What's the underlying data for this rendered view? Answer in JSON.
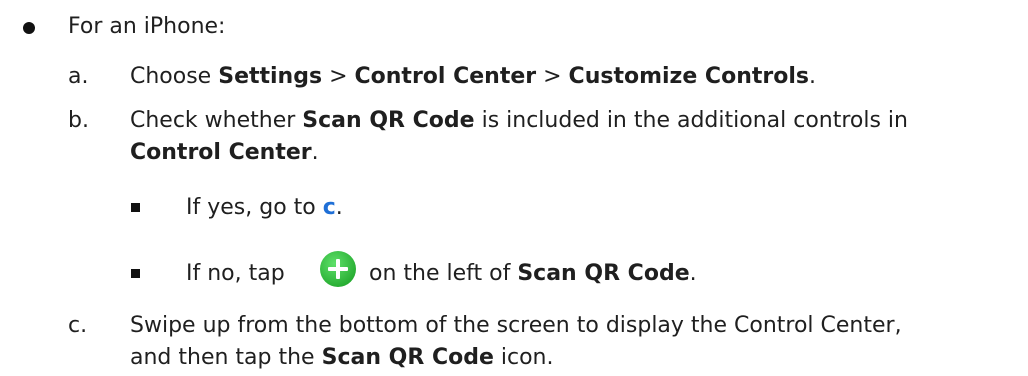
{
  "intro": "For an iPhone:",
  "steps": {
    "a": {
      "letter": "a.",
      "text1": "Choose ",
      "settings": "Settings",
      "sep1": " > ",
      "control_center": "Control Center",
      "sep2": " > ",
      "customize": "Customize Controls",
      "end": "."
    },
    "b": {
      "letter": "b.",
      "text1": "Check whether ",
      "scan_qr": "Scan QR Code",
      "text2": " is included in the additional controls in",
      "control_center": "Control Center",
      "end": "."
    },
    "c": {
      "letter": "c.",
      "line1": "Swipe up from the bottom of the screen to display the Control Center,",
      "text1": "and then tap the ",
      "scan_qr": "Scan QR Code",
      "text2": " icon."
    }
  },
  "sub": {
    "yes": {
      "text": "If yes, go to ",
      "link": "c",
      "end": "."
    },
    "no": {
      "text1": "If no, tap",
      "text2": "on the left of ",
      "scan_qr": "Scan QR Code",
      "end": "."
    }
  },
  "icons": {
    "plus": "green-plus-circle-icon",
    "plus_color": "#2fbf3a"
  }
}
